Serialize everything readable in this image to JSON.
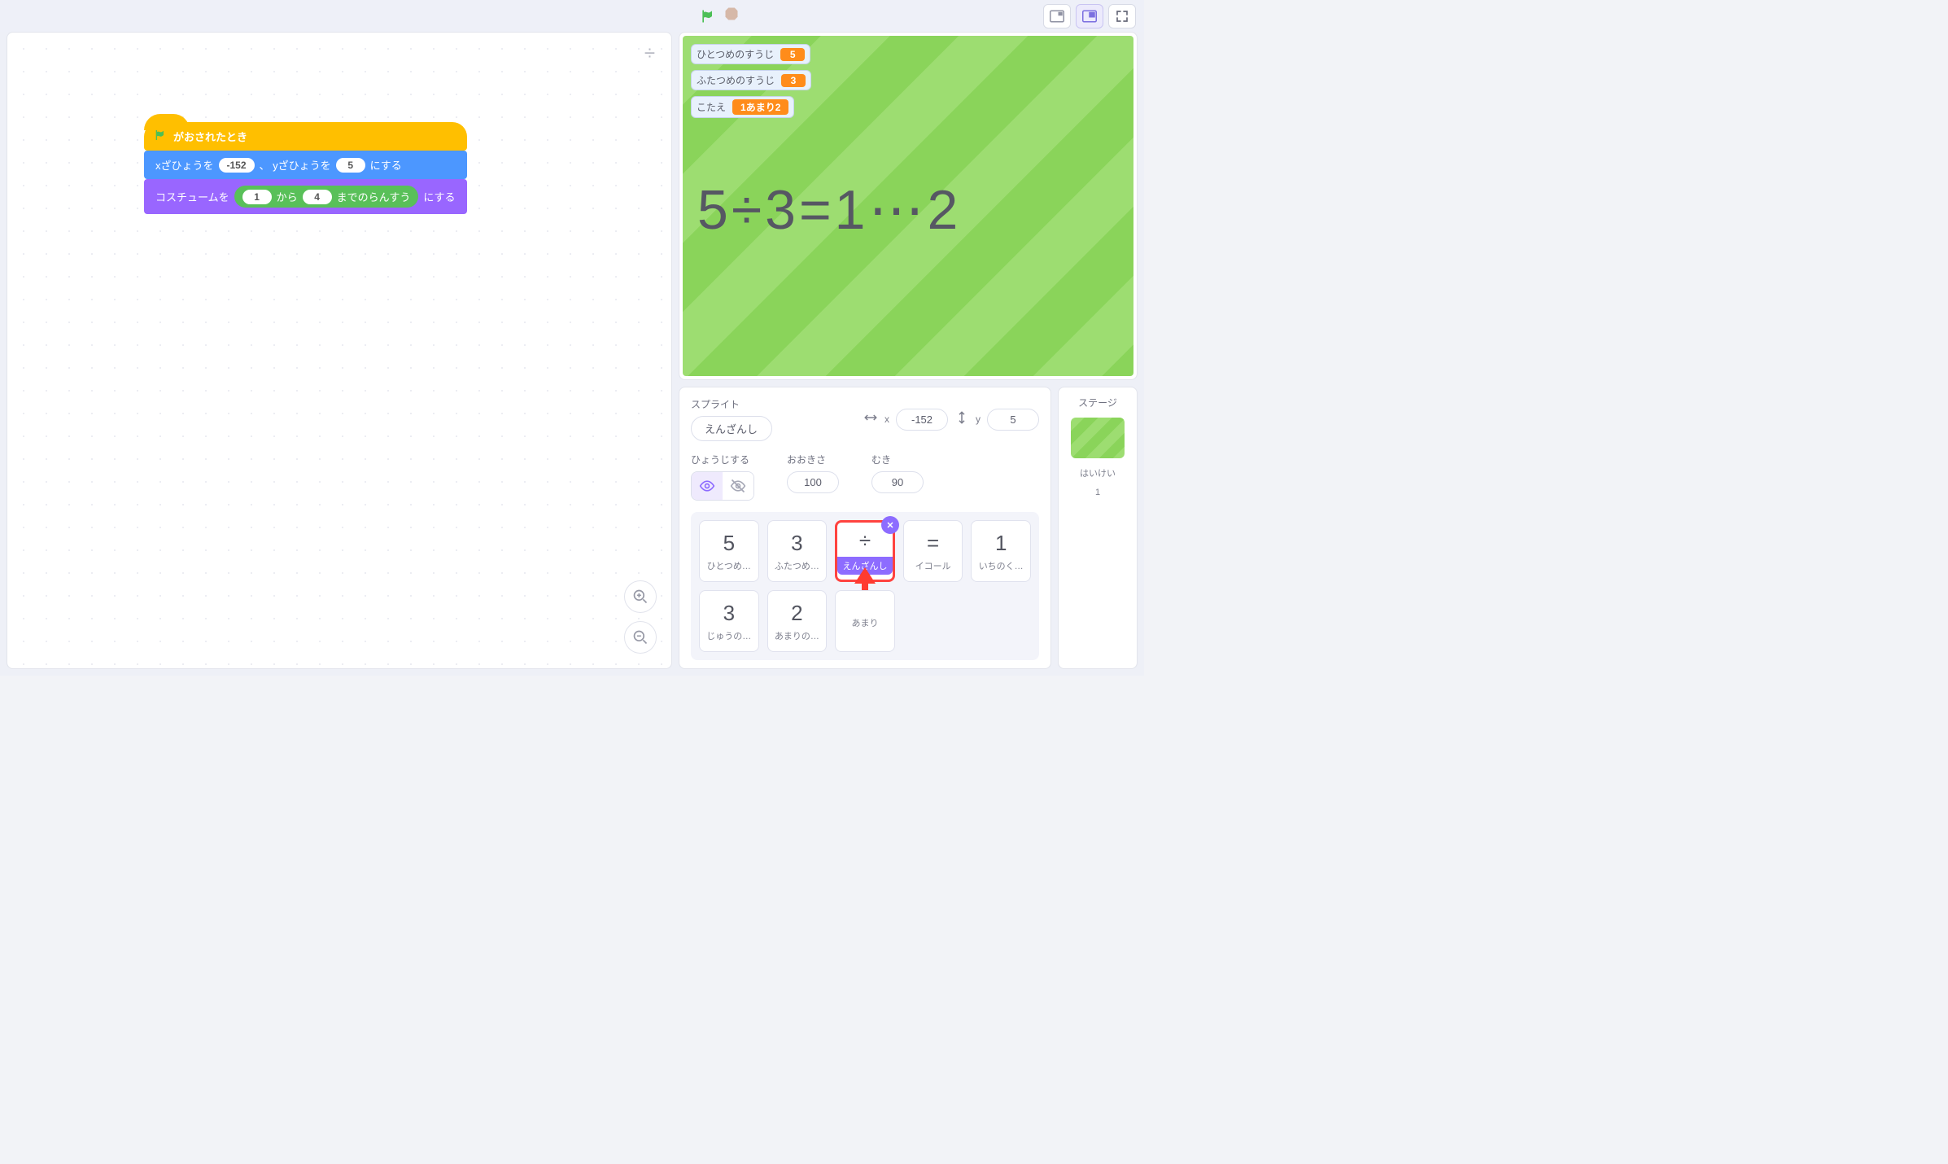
{
  "blocks": {
    "hat": "がおされたとき",
    "motion": {
      "xlabel": "xざひょうを",
      "xval": "-152",
      "mid": "、 yざひょうを",
      "yval": "5",
      "end": "にする"
    },
    "looks": {
      "pre": "コスチュームを",
      "from": "1",
      "mid": "から",
      "to": "4",
      "suf": "までのらんすう",
      "end": "にする"
    }
  },
  "toolbar_icon": "÷",
  "monitors": {
    "m1": {
      "label": "ひとつめのすうじ",
      "value": "5"
    },
    "m2": {
      "label": "ふたつめのすうじ",
      "value": "3"
    },
    "m3": {
      "label": "こたえ",
      "value": "1あまり2"
    }
  },
  "equation": "5÷3=1⋯2",
  "sprite_panel": {
    "title": "スプライト",
    "name": "えんざんし",
    "x_label": "x",
    "x_val": "-152",
    "y_label": "y",
    "y_val": "5",
    "show": "ひょうじする",
    "size_label": "おおきさ",
    "size_val": "100",
    "dir_label": "むき",
    "dir_val": "90"
  },
  "sprites": [
    {
      "big": "5",
      "lab": "ひとつめ…"
    },
    {
      "big": "3",
      "lab": "ふたつめ…"
    },
    {
      "big": "÷",
      "lab": "えんざんし",
      "selected": true
    },
    {
      "big": "=",
      "lab": "イコール"
    },
    {
      "big": "1",
      "lab": "いちのく…"
    },
    {
      "big": "3",
      "lab": "じゅうの…"
    },
    {
      "big": "2",
      "lab": "あまりの…"
    },
    {
      "big": "",
      "lab": "あまり"
    }
  ],
  "stage_panel": {
    "title": "ステージ",
    "cap1": "はいけい",
    "cap2": "1"
  }
}
